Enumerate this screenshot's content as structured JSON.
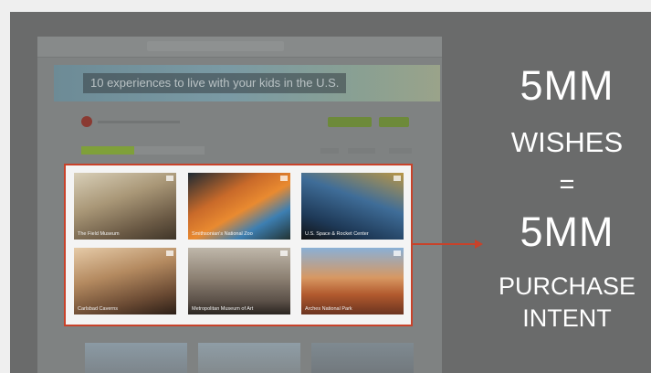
{
  "webpage": {
    "banner_title": "10 experiences to live with your kids in the U.S.",
    "cards": [
      {
        "category": "",
        "title": "The Field Museum"
      },
      {
        "category": "",
        "title": "Smithsonian's National Zoo"
      },
      {
        "category": "",
        "title": "U.S. Space & Rocket Center"
      },
      {
        "category": "",
        "title": "Carlsbad Caverns"
      },
      {
        "category": "",
        "title": "Metropolitan Museum of Art"
      },
      {
        "category": "",
        "title": "Arches National Park"
      }
    ]
  },
  "stats": {
    "line1": "5MM",
    "line2": "WISHES",
    "line3": "=",
    "line4": "5MM",
    "line5": "PURCHASE",
    "line6": "INTENT"
  },
  "colors": {
    "highlight": "#c8422a",
    "slide_background": "#6a6b6b",
    "text": "#ffffff"
  }
}
